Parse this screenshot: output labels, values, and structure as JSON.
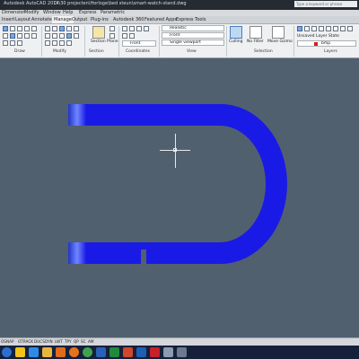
{
  "titlebar": {
    "app_title": "Autodesk AutoCAD 2014",
    "file_path": "D:\\30 projecten\\Horloge\\bed steun\\smart-watch-stand.dwg",
    "search_placeholder": "Type a keyword or phrase"
  },
  "menubar": {
    "items": [
      "Dimension",
      "Modify",
      "Window",
      "Help",
      "Express",
      "Parametric"
    ]
  },
  "tabs": [
    "Insert",
    "Layout",
    "Annotate",
    "Manage",
    "Output",
    "Plug-ins",
    "Autodesk 360",
    "Featured Apps",
    "Express Tools"
  ],
  "ribbon": {
    "panels": [
      "Draw",
      "Modify",
      "Section",
      "Coordinates",
      "View",
      "Selection",
      "Layers"
    ],
    "section_plane_label": "Section Plane",
    "visual_style": "Realistic",
    "view_direction": "Front",
    "ucs": "Front",
    "viewport_config": "Single viewport",
    "culling_label": "Culling",
    "no_filter_label": "No Filter",
    "move_gizmo_label": "Move Gizmo",
    "layer_state": "Unsaved Layer State",
    "current_layer": "bmp"
  },
  "statusbar": {
    "items": [
      "OSNAP",
      "OTRACK",
      "DUCS",
      "DYN",
      "LWT",
      "TPY",
      "QP",
      "SC",
      "AM"
    ]
  },
  "colors": {
    "shape_fill": "#1a1ae6",
    "viewport_bg": "#51606f",
    "title_bg": "#252b33"
  },
  "taskbar": {
    "apps": [
      "start-icon",
      "explorer-icon",
      "ie-icon",
      "folder-icon",
      "media-icon",
      "firefox-icon",
      "chrome-icon",
      "word-icon",
      "excel-icon",
      "powerpoint-icon",
      "outlook-icon",
      "autocad-icon",
      "tool-icon",
      "tool-icon"
    ]
  }
}
